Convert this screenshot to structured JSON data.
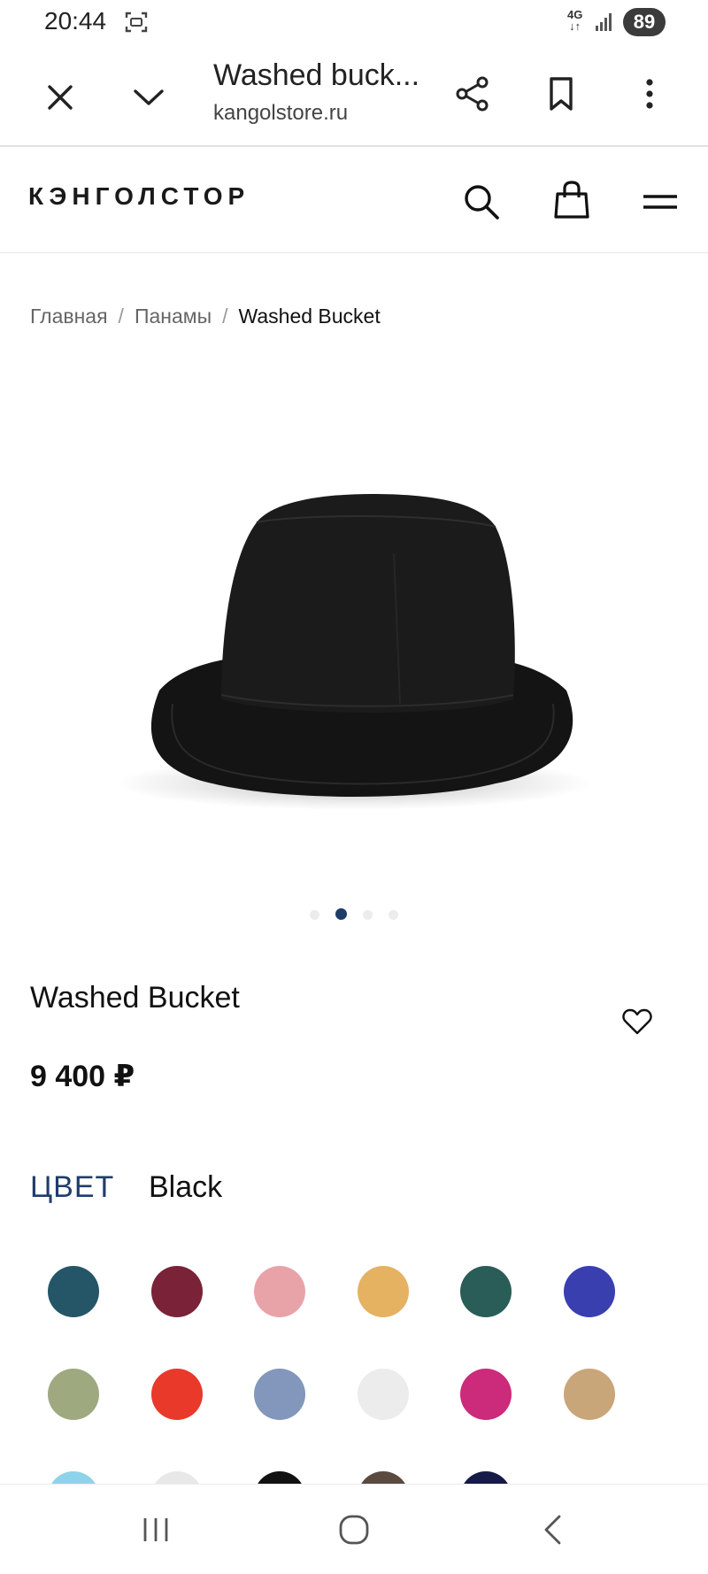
{
  "status_bar": {
    "time": "20:44",
    "network": "4G",
    "battery": "89"
  },
  "browser": {
    "page_title": "Washed buck...",
    "url": "kangolstore.ru",
    "icons": [
      "close-icon",
      "chevron-down-icon",
      "share-icon",
      "bookmark-icon",
      "more-vert-icon"
    ]
  },
  "site": {
    "logo": "КЭНГОЛСТОР",
    "icons": [
      "search-icon",
      "shopping-bag-icon",
      "hamburger-menu-icon"
    ]
  },
  "breadcrumb": {
    "items": [
      "Главная",
      "Панамы",
      "Washed Bucket"
    ],
    "separator": "/"
  },
  "gallery": {
    "image_count": 4,
    "active_index": 1
  },
  "product": {
    "title": "Washed Bucket",
    "price": "9 400 ₽",
    "color_label": "ЦВЕТ",
    "selected_color": "Black"
  },
  "swatches": [
    "#255668",
    "#7a2237",
    "#e8a3a9",
    "#e5b261",
    "#2a5d58",
    "#3a3fb0",
    "#9ea980",
    "#e8392a",
    "#8396bb",
    "#ececec",
    "#cc2a7b",
    "#c9a679",
    "#8fd3ea",
    "#e8e8e8",
    "#111111",
    "#5a4a40",
    "#161a47"
  ],
  "colors": {
    "accent": "#1f3d6b",
    "text": "#111111",
    "muted": "#666666"
  }
}
